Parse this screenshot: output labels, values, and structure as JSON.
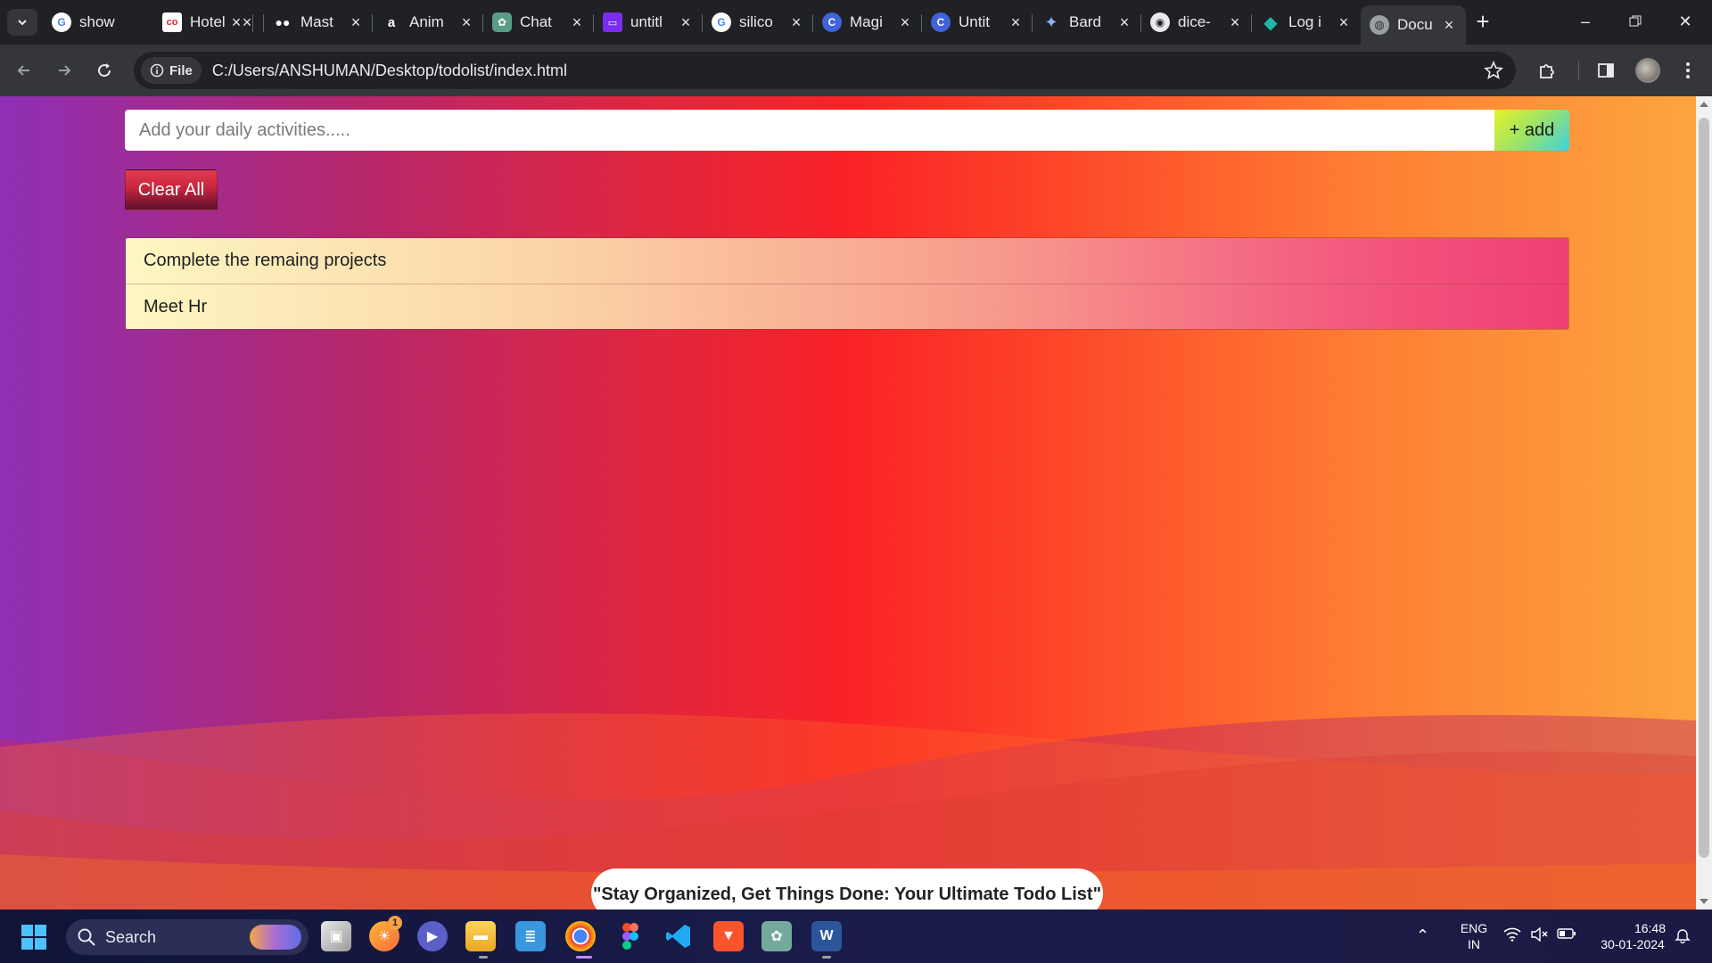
{
  "browser": {
    "tabs": [
      {
        "title": "show",
        "icon": "google-icon"
      },
      {
        "title": "Hotel",
        "icon": "co-icon"
      },
      {
        "title": "Mast",
        "icon": "medium-icon"
      },
      {
        "title": "Anim",
        "icon": "a-icon"
      },
      {
        "title": "Chat",
        "icon": "chatgpt-icon"
      },
      {
        "title": "untitl",
        "icon": "twitch-icon"
      },
      {
        "title": "silico",
        "icon": "google-icon"
      },
      {
        "title": "Magi",
        "icon": "c-icon"
      },
      {
        "title": "Untit",
        "icon": "c-icon"
      },
      {
        "title": "Bard",
        "icon": "bard-icon"
      },
      {
        "title": "dice-",
        "icon": "github-icon"
      },
      {
        "title": "Log i",
        "icon": "diamond-icon"
      },
      {
        "title": "Docu",
        "icon": "globe-icon",
        "active": true
      }
    ],
    "address_chip": "File",
    "url": "C:/Users/ANSHUMAN/Desktop/todolist/index.html"
  },
  "app": {
    "input_placeholder": "Add your daily activities.....",
    "add_label": "+ add",
    "clear_label": "Clear All",
    "todos": [
      "Complete the remaing projects",
      "Meet Hr"
    ],
    "footer_quote": "\"Stay Organized, Get Things Done: Your Ultimate Todo List\""
  },
  "taskbar": {
    "search_label": "Search",
    "notification_count": "1",
    "language_line1": "ENG",
    "language_line2": "IN",
    "time": "16:48",
    "date": "30-01-2024"
  },
  "colors": {
    "gradient_left": "#8f2fb5",
    "gradient_mid": "#fa2226",
    "gradient_right": "#fca53f"
  }
}
